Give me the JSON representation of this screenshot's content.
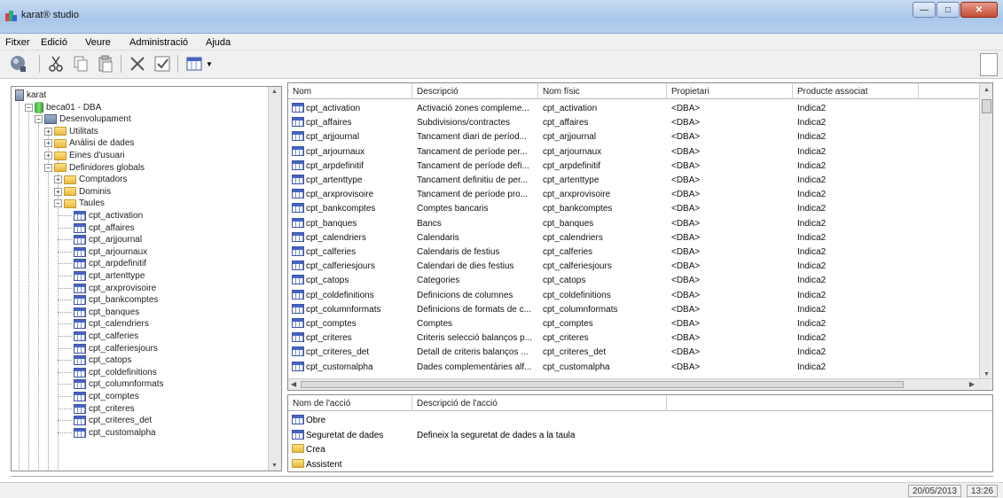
{
  "window": {
    "title": "karat® studio"
  },
  "menu": [
    "Fitxer",
    "Edició",
    "Veure",
    "Administració",
    "Ajuda"
  ],
  "toolbar": {
    "icons": [
      "connect-icon",
      "cut-icon",
      "copy-icon",
      "paste-icon",
      "delete-icon",
      "check-icon",
      "view-grid-icon",
      "dropdown-arrow-icon"
    ]
  },
  "tree": {
    "nodes": [
      {
        "label": "karat",
        "icon": "server-icon",
        "level": 0,
        "expander": ""
      },
      {
        "label": "beca01 - DBA",
        "icon": "database-icon",
        "level": 1,
        "expander": "−"
      },
      {
        "label": "Desenvolupament",
        "icon": "development-icon",
        "level": 2,
        "expander": "−"
      },
      {
        "label": "Utilitats",
        "icon": "folder-icon",
        "level": 3,
        "expander": "+"
      },
      {
        "label": "Anàlisi de dades",
        "icon": "folder-icon",
        "level": 3,
        "expander": "+"
      },
      {
        "label": "Eines d'usuari",
        "icon": "folder-icon",
        "level": 3,
        "expander": "+"
      },
      {
        "label": "Definidores globals",
        "icon": "folder-icon",
        "level": 3,
        "expander": "−"
      },
      {
        "label": "Comptadors",
        "icon": "folder-icon",
        "level": 4,
        "expander": "+"
      },
      {
        "label": "Dominis",
        "icon": "folder-icon",
        "level": 4,
        "expander": "+"
      },
      {
        "label": "Taules",
        "icon": "folder-icon",
        "level": 4,
        "expander": "−"
      },
      {
        "label": "cpt_activation",
        "icon": "table-icon",
        "level": 5,
        "expander": ""
      },
      {
        "label": "cpt_affaires",
        "icon": "table-icon",
        "level": 5,
        "expander": ""
      },
      {
        "label": "cpt_arjjournal",
        "icon": "table-icon",
        "level": 5,
        "expander": ""
      },
      {
        "label": "cpt_arjournaux",
        "icon": "table-icon",
        "level": 5,
        "expander": ""
      },
      {
        "label": "cpt_arpdefinitif",
        "icon": "table-icon",
        "level": 5,
        "expander": ""
      },
      {
        "label": "cpt_artenttype",
        "icon": "table-icon",
        "level": 5,
        "expander": ""
      },
      {
        "label": "cpt_arxprovisoire",
        "icon": "table-icon",
        "level": 5,
        "expander": ""
      },
      {
        "label": "cpt_bankcomptes",
        "icon": "table-icon",
        "level": 5,
        "expander": ""
      },
      {
        "label": "cpt_banques",
        "icon": "table-icon",
        "level": 5,
        "expander": ""
      },
      {
        "label": "cpt_calendriers",
        "icon": "table-icon",
        "level": 5,
        "expander": ""
      },
      {
        "label": "cpt_calferies",
        "icon": "table-icon",
        "level": 5,
        "expander": ""
      },
      {
        "label": "cpt_calferiesjours",
        "icon": "table-icon",
        "level": 5,
        "expander": ""
      },
      {
        "label": "cpt_catops",
        "icon": "table-icon",
        "level": 5,
        "expander": ""
      },
      {
        "label": "cpt_coldefinitions",
        "icon": "table-icon",
        "level": 5,
        "expander": ""
      },
      {
        "label": "cpt_columnformats",
        "icon": "table-icon",
        "level": 5,
        "expander": ""
      },
      {
        "label": "cpt_comptes",
        "icon": "table-icon",
        "level": 5,
        "expander": ""
      },
      {
        "label": "cpt_criteres",
        "icon": "table-icon",
        "level": 5,
        "expander": ""
      },
      {
        "label": "cpt_criteres_det",
        "icon": "table-icon",
        "level": 5,
        "expander": ""
      },
      {
        "label": "cpt_customalpha",
        "icon": "table-icon",
        "level": 5,
        "expander": ""
      }
    ]
  },
  "grid": {
    "columns": [
      "Nom",
      "Descripció",
      "Nom físic",
      "Propietari",
      "Producte associat"
    ],
    "rows": [
      [
        "cpt_activation",
        "Activació zones compleme...",
        "cpt_activation",
        "<DBA>",
        "Indica2"
      ],
      [
        "cpt_affaires",
        "Subdivisions/contractes",
        "cpt_affaires",
        "<DBA>",
        "Indica2"
      ],
      [
        "cpt_arjjournal",
        "Tancament diari de períod...",
        "cpt_arjjournal",
        "<DBA>",
        "Indica2"
      ],
      [
        "cpt_arjournaux",
        "Tancament de període per...",
        "cpt_arjournaux",
        "<DBA>",
        "Indica2"
      ],
      [
        "cpt_arpdefinitif",
        "Tancament de període defi...",
        "cpt_arpdefinitif",
        "<DBA>",
        "Indica2"
      ],
      [
        "cpt_artenttype",
        "Tancament definitiu de per...",
        "cpt_artenttype",
        "<DBA>",
        "Indica2"
      ],
      [
        "cpt_arxprovisoire",
        "Tancament de període pro...",
        "cpt_arxprovisoire",
        "<DBA>",
        "Indica2"
      ],
      [
        "cpt_bankcomptes",
        "Comptes bancaris",
        "cpt_bankcomptes",
        "<DBA>",
        "Indica2"
      ],
      [
        "cpt_banques",
        "Bancs",
        "cpt_banques",
        "<DBA>",
        "Indica2"
      ],
      [
        "cpt_calendriers",
        "Calendaris",
        "cpt_calendriers",
        "<DBA>",
        "Indica2"
      ],
      [
        "cpt_calferies",
        "Calendaris de festius",
        "cpt_calferies",
        "<DBA>",
        "Indica2"
      ],
      [
        "cpt_calferiesjours",
        "Calendari de dies festius",
        "cpt_calferiesjours",
        "<DBA>",
        "Indica2"
      ],
      [
        "cpt_catops",
        "Categories",
        "cpt_catops",
        "<DBA>",
        "Indica2"
      ],
      [
        "cpt_coldefinitions",
        "Definicions de columnes",
        "cpt_coldefinitions",
        "<DBA>",
        "Indica2"
      ],
      [
        "cpt_columnformats",
        "Definicions de formats de c...",
        "cpt_columnformats",
        "<DBA>",
        "Indica2"
      ],
      [
        "cpt_comptes",
        "Comptes",
        "cpt_comptes",
        "<DBA>",
        "Indica2"
      ],
      [
        "cpt_criteres",
        "Criteris selecció balanços p...",
        "cpt_criteres",
        "<DBA>",
        "Indica2"
      ],
      [
        "cpt_criteres_det",
        "Detall de criteris balanços ...",
        "cpt_criteres_det",
        "<DBA>",
        "Indica2"
      ],
      [
        "cpt_customalpha",
        "Dades complementàries alf...",
        "cpt_customalpha",
        "<DBA>",
        "Indica2"
      ]
    ]
  },
  "actions": {
    "columns": [
      "Nom de l'acció",
      "Descripció de l'acció"
    ],
    "rows": [
      {
        "name": "Obre",
        "description": "",
        "icon": "table-icon"
      },
      {
        "name": "Seguretat de dades",
        "description": "Defineix la seguretat de dades a la taula",
        "icon": "table-icon"
      },
      {
        "name": "Crea",
        "description": "",
        "icon": "folder-icon"
      },
      {
        "name": "Assistent",
        "description": "",
        "icon": "folder-icon"
      }
    ]
  },
  "status": {
    "date": "20/05/2013",
    "time": "13:26"
  }
}
